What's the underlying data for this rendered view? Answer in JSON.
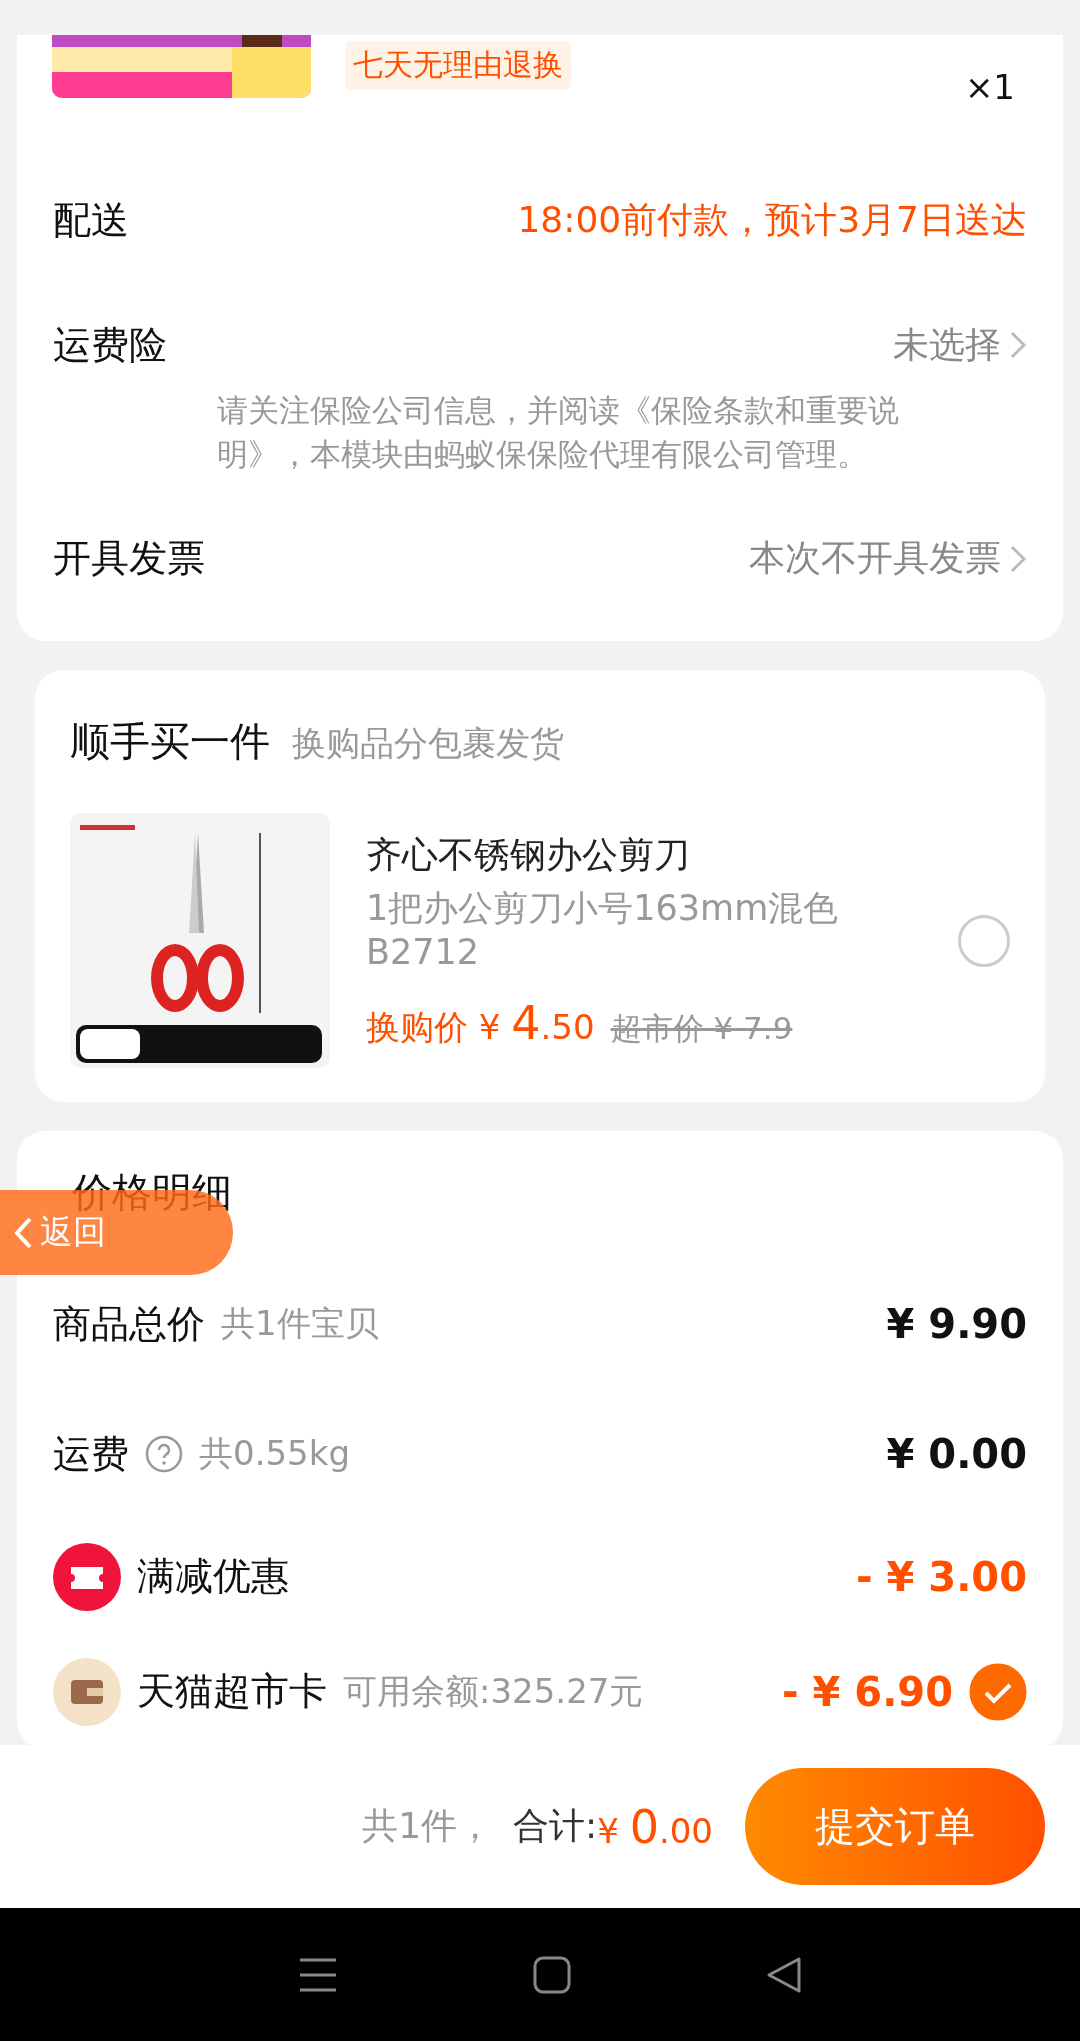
{
  "order_item": {
    "service_tag": "七天无理由退换",
    "quantity": "×1"
  },
  "order_rows": [
    {
      "label": "配送",
      "value": "18:00前付款，预计3月7日送达",
      "kind": "highlight",
      "chevron": false
    },
    {
      "label": "运费险",
      "value": "未选择",
      "kind": "muted",
      "chevron": true,
      "note": "请关注保险公司信息，并阅读《保险条款和重要说明》，本模块由蚂蚁保保险代理有限公司管理。"
    },
    {
      "label": "开具发票",
      "value": "本次不开具发票",
      "kind": "muted",
      "chevron": true
    }
  ],
  "add_on": {
    "title": "顺手买一件",
    "subtitle": "换购品分包裹发货",
    "product": {
      "name": "齐心不锈钢办公剪刀",
      "spec": "1把办公剪刀小号163mm混色B2712",
      "price_label": "换购价",
      "price_symbol": "¥",
      "price_int": "4",
      "price_dec": ".50",
      "old_price": "超市价 ¥ 7.9",
      "selected": false
    }
  },
  "price_detail": {
    "title": "价格明细",
    "rows": [
      {
        "kind": "plain",
        "label": "商品总价",
        "hint": "共1件宝贝",
        "amount": "¥ 9.90"
      },
      {
        "kind": "help",
        "label": "运费",
        "hint": "共0.55kg",
        "amount": "¥ 0.00"
      },
      {
        "kind": "coupon",
        "label": "满减优惠",
        "amount": "- ¥ 3.00"
      },
      {
        "kind": "card",
        "label": "天猫超市卡",
        "hint": "可用余额:325.27元",
        "amount": "- ¥ 6.90",
        "checked": true
      }
    ]
  },
  "back_button": "返回",
  "footer": {
    "count": "共1件，",
    "total_label": "合计:",
    "symbol": "¥",
    "total_int": "0",
    "total_dec": ".00",
    "submit": "提交订单"
  }
}
